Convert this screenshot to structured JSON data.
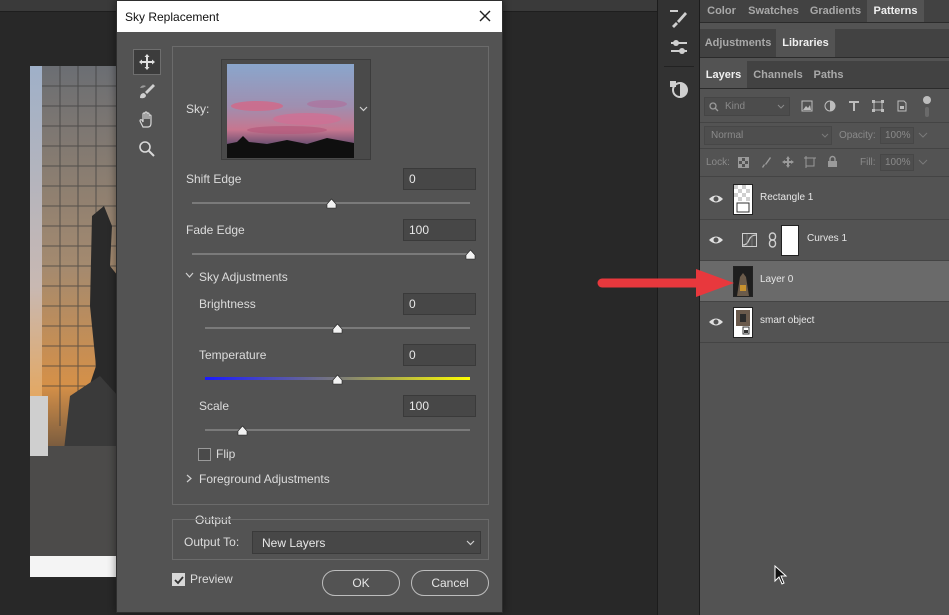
{
  "dialog": {
    "title": "Sky Replacement",
    "sky_label": "Sky:",
    "shift_edge": {
      "label": "Shift Edge",
      "value": "0",
      "level_percent": 50
    },
    "fade_edge": {
      "label": "Fade Edge",
      "value": "100",
      "level_percent": 100
    },
    "sky_adjustments": {
      "label": "Sky Adjustments",
      "expanded": true
    },
    "brightness": {
      "label": "Brightness",
      "value": "0",
      "level_percent": 50
    },
    "temperature": {
      "label": "Temperature",
      "value": "0",
      "level_percent": 50
    },
    "scale": {
      "label": "Scale",
      "value": "100",
      "level_percent": 14
    },
    "flip": {
      "label": "Flip",
      "checked": false
    },
    "foreground_adjustments": {
      "label": "Foreground Adjustments",
      "expanded": false
    },
    "output": {
      "group_label": "Output",
      "output_to_label": "Output To:",
      "output_to_value": "New Layers"
    },
    "preview": {
      "label": "Preview",
      "checked": true
    },
    "ok_label": "OK",
    "cancel_label": "Cancel",
    "tools": [
      "move-sky-icon",
      "sky-brush-icon",
      "hand-icon",
      "zoom-icon"
    ]
  },
  "panels": {
    "top_tabs": [
      "Color",
      "Swatches",
      "Gradients",
      "Patterns"
    ],
    "top_active": "Patterns",
    "mid_tabs": [
      "Adjustments",
      "Libraries"
    ],
    "mid_active": "Libraries",
    "layer_tabs": [
      "Layers",
      "Channels",
      "Paths"
    ],
    "layer_active": "Layers",
    "filter_kind": "Kind",
    "blend_mode": "Normal",
    "opacity_label": "Opacity:",
    "opacity_value": "100%",
    "lock_label": "Lock:",
    "fill_label": "Fill:",
    "fill_value": "100%",
    "layers": [
      {
        "name": "Rectangle 1",
        "visible": true,
        "selected": false
      },
      {
        "name": "Curves 1",
        "visible": true,
        "selected": false
      },
      {
        "name": "Layer 0",
        "visible": false,
        "selected": true
      },
      {
        "name": "smart object",
        "visible": true,
        "selected": false
      }
    ]
  },
  "colors": {
    "annotation_arrow": "#e8383d",
    "dialog_bg": "#535353",
    "panel_bg": "#535353",
    "temperature_gradient": [
      "#1a1aff",
      "#7a7a7a",
      "#ffff00"
    ]
  }
}
